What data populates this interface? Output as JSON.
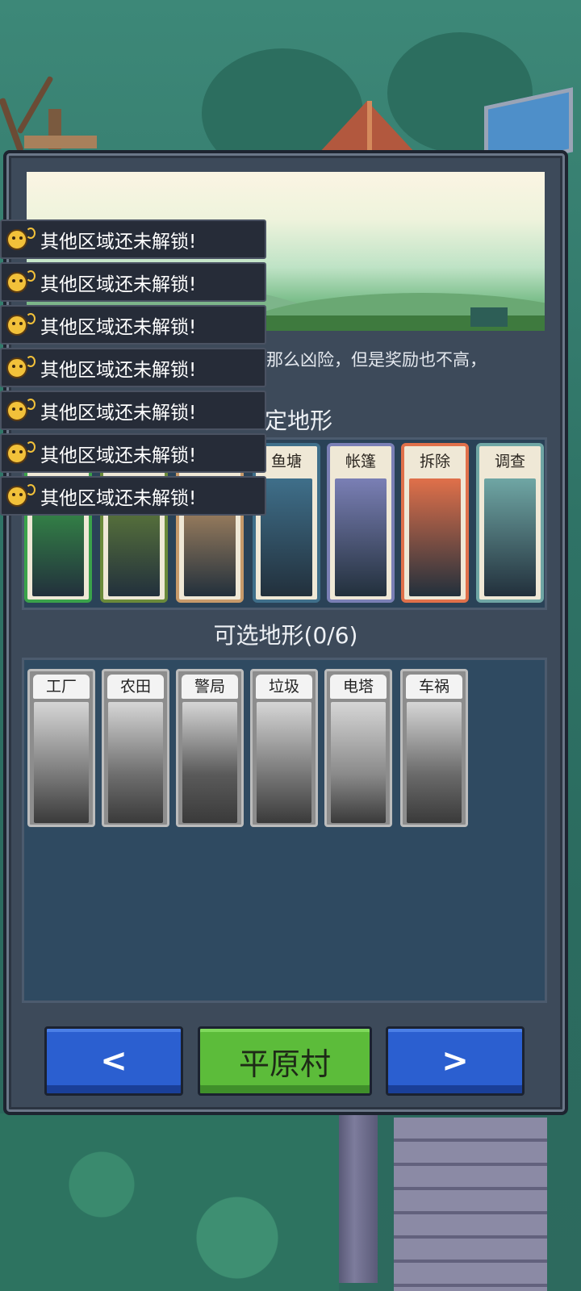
{
  "location": {
    "name": "平原村",
    "description_fragment": "那么凶险，但是奖励也不高，"
  },
  "fixed_terrain": {
    "title_fragment": "定地形",
    "cards": [
      {
        "label": "",
        "color": "#3aa24a"
      },
      {
        "label": "",
        "color": "#6b8a3a"
      },
      {
        "label": "",
        "color": "#c79a6a"
      },
      {
        "label": "鱼塘",
        "color": "#3f6f8a"
      },
      {
        "label": "帐篷",
        "color": "#7a7fb5"
      },
      {
        "label": "拆除",
        "color": "#e0704a"
      },
      {
        "label": "调查",
        "color": "#6fa6a4"
      }
    ]
  },
  "optional_terrain": {
    "title": "可选地形(0/6)",
    "cards": [
      {
        "label": "工厂"
      },
      {
        "label": "农田"
      },
      {
        "label": "警局"
      },
      {
        "label": "垃圾"
      },
      {
        "label": "电塔"
      },
      {
        "label": "车祸"
      }
    ]
  },
  "navigation": {
    "prev_label": "<",
    "next_label": ">",
    "current_label": "平原村"
  },
  "toasts": [
    {
      "text": "其他区域还未解锁!"
    },
    {
      "text": "其他区域还未解锁!"
    },
    {
      "text": "其他区域还未解锁!"
    },
    {
      "text": "其他区域还未解锁!"
    },
    {
      "text": "其他区域还未解锁!"
    },
    {
      "text": "其他区域还未解锁!"
    },
    {
      "text": "其他区域还未解锁!"
    }
  ],
  "icons": {
    "toast_icon": "dizzy-face-icon",
    "prev_icon": "chevron-left-icon",
    "next_icon": "chevron-right-icon"
  },
  "colors": {
    "panel_bg": "#3d4a5a",
    "button_blue": "#2b5fd0",
    "button_green": "#5cbc3a"
  }
}
